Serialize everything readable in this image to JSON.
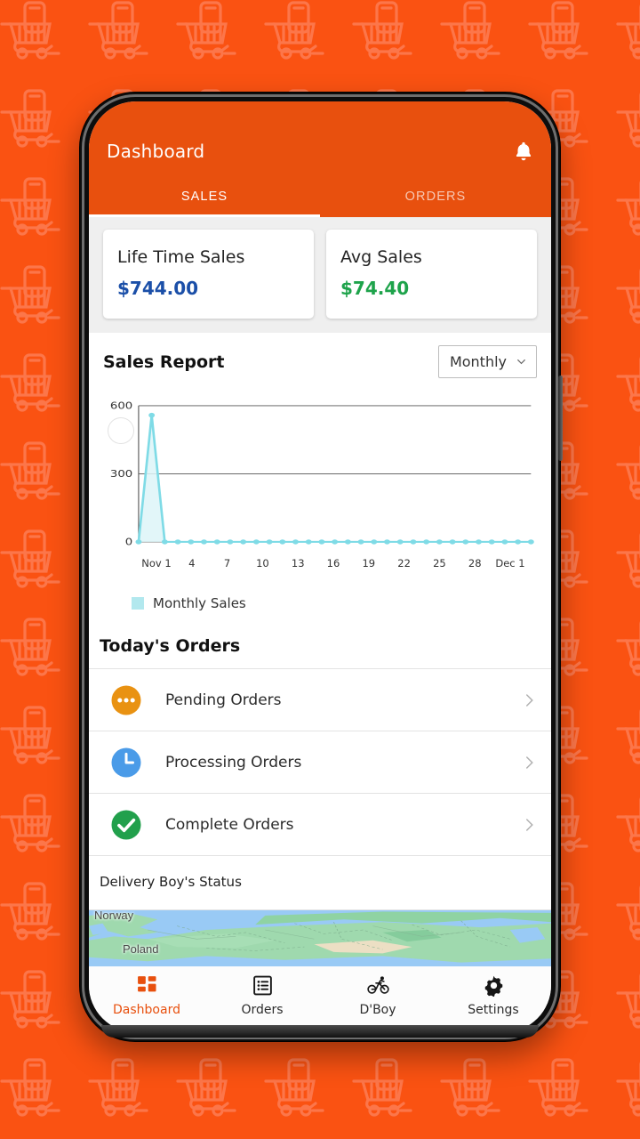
{
  "background": {
    "color": "#FA5212",
    "pattern_icon": "shopping-cart-with-phone-icon",
    "pattern_color": "#FC764A"
  },
  "appbar": {
    "title": "Dashboard",
    "bg_color": "#E8500E",
    "notification_icon": "bell-icon",
    "tabs": [
      {
        "label": "SALES",
        "active": true
      },
      {
        "label": "ORDERS",
        "active": false
      }
    ]
  },
  "stats": [
    {
      "label": "Life Time Sales",
      "value": "$744.00",
      "color": "#1B4FA8"
    },
    {
      "label": "Avg Sales",
      "value": "$74.40",
      "color": "#1EA34B"
    }
  ],
  "sales_report": {
    "title": "Sales Report",
    "period_selected": "Monthly",
    "period_icon": "chevron-down-icon",
    "legend_label": "Monthly Sales",
    "legend_color": "#b2e8ee"
  },
  "chart_data": {
    "type": "line",
    "title": "Sales Report",
    "xlabel": "",
    "ylabel": "",
    "ylim": [
      0,
      600
    ],
    "yticks": [
      0,
      300,
      600
    ],
    "ytick_labels": [
      "0",
      "300",
      "600"
    ],
    "grid": true,
    "legend_position": "bottom-left",
    "line_color": "#7fdbe6",
    "fill_color": "#ddf5f8",
    "marker_color": "#7fdbe6",
    "series": [
      {
        "name": "Monthly Sales",
        "values": [
          0,
          558,
          0,
          0,
          0,
          0,
          0,
          0,
          0,
          0,
          0,
          0,
          0,
          0,
          0,
          0,
          0,
          0,
          0,
          0,
          0,
          0,
          0,
          0,
          0,
          0,
          0,
          0,
          0,
          0,
          0
        ]
      }
    ],
    "x": [
      "Nov 1",
      "Nov 2",
      "Nov 3",
      "Nov 4",
      "Nov 5",
      "Nov 6",
      "Nov 7",
      "Nov 8",
      "Nov 9",
      "Nov 10",
      "Nov 11",
      "Nov 12",
      "Nov 13",
      "Nov 14",
      "Nov 15",
      "Nov 16",
      "Nov 17",
      "Nov 18",
      "Nov 19",
      "Nov 20",
      "Nov 21",
      "Nov 22",
      "Nov 23",
      "Nov 24",
      "Nov 25",
      "Nov 26",
      "Nov 27",
      "Nov 28",
      "Nov 29",
      "Nov 30",
      "Dec 1"
    ],
    "xtick_labels": [
      "Nov 1",
      "4",
      "7",
      "10",
      "13",
      "16",
      "19",
      "22",
      "25",
      "28",
      "Dec 1"
    ],
    "xtick_indices": [
      0,
      3,
      6,
      9,
      12,
      15,
      18,
      21,
      24,
      27,
      30
    ]
  },
  "todays_orders": {
    "title": "Today's Orders",
    "rows": [
      {
        "label": "Pending Orders",
        "icon": "three-dots-circle-icon",
        "icon_color": "#E99212",
        "chevron": "chevron-right-icon"
      },
      {
        "label": "Processing Orders",
        "icon": "clock-circle-icon",
        "icon_color": "#4A9BE8",
        "chevron": "chevron-right-icon"
      },
      {
        "label": "Complete Orders",
        "icon": "check-circle-icon",
        "icon_color": "#22A04C",
        "chevron": "chevron-right-icon"
      }
    ]
  },
  "delivery_boy": {
    "status_label": "Delivery Boy's Status"
  },
  "map": {
    "labels": [
      "Norway",
      "Poland"
    ],
    "land_color": "#9fd9ae",
    "water_color": "#99caf5"
  },
  "bottom_nav": {
    "active_color": "#E8500E",
    "items": [
      {
        "label": "Dashboard",
        "icon": "dashboard-grid-icon",
        "active": true
      },
      {
        "label": "Orders",
        "icon": "list-icon",
        "active": false
      },
      {
        "label": "D'Boy",
        "icon": "bicycle-icon",
        "active": false
      },
      {
        "label": "Settings",
        "icon": "gear-icon",
        "active": false
      }
    ]
  }
}
